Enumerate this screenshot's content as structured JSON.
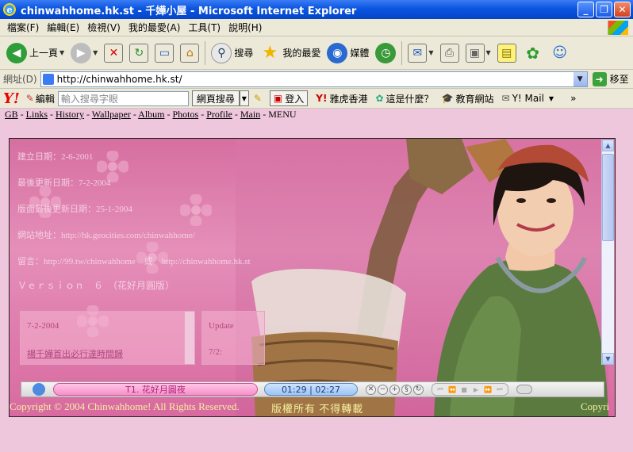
{
  "window": {
    "title": "chinwahhome.hk.st - 千嬅小屋 - Microsoft Internet Explorer",
    "buttons": {
      "minimize": "_",
      "maximize": "❐",
      "close": "✕"
    }
  },
  "menu": [
    "檔案(F)",
    "編輯(E)",
    "檢視(V)",
    "我的最愛(A)",
    "工具(T)",
    "說明(H)"
  ],
  "toolbar": {
    "back": "上一頁",
    "search": "搜尋",
    "favorites": "我的最愛",
    "media": "媒體"
  },
  "address": {
    "label": "網址(D)",
    "url": "http://chinwahhome.hk.st/",
    "go": "移至"
  },
  "yahoo": {
    "logo": "Y!",
    "edit": "編輯",
    "search_placeholder": "輸入搜尋字眼",
    "web_search": "網頁搜尋",
    "login": "登入",
    "hk": "雅虎香港",
    "whatis": "這是什麼？",
    "education": "教育網站",
    "mail": "Y! Mail",
    "more": "»"
  },
  "nav": {
    "gb": "GB",
    "links": "Links",
    "history": "History",
    "wallpaper": "Wallpaper",
    "album": "Album",
    "photos": "Photos",
    "profile": "Profile",
    "main": "Main",
    "menu": "MENU",
    "sep": " - "
  },
  "info": {
    "line1": "建立日期：2-6-2001",
    "line2": "最後更新日期：7-2-2004",
    "line3": "版面最後更新日期：25-1-2004",
    "line4": "網站地址：http://hk.geocities.com/chinwahhome/",
    "line5": "留言：http://99.tw/chinwahhome　或　http://chinwahhome.hk.st",
    "line6": "Ｖｅｒｓｉｏｎ　６　（花好月圓版）"
  },
  "news": {
    "date": "7-2-2004",
    "link": "楊千嬅首出必行達時間歸",
    "update_label": "Update",
    "update_date": "7/2:"
  },
  "player": {
    "track": "T1. 花好月圓夜",
    "time": "01:29 | 02:27"
  },
  "footer": {
    "copyright": "Copyright © 2004 Chinwahhome! All Rights Reserved.",
    "notice": "版權所有 不得轉載",
    "copyright_repeat": "Copyri"
  },
  "colors": {
    "page_bg": "#efc7dd",
    "banner_pink": "#d66fa0",
    "footer_text": "#f5f0a0"
  }
}
